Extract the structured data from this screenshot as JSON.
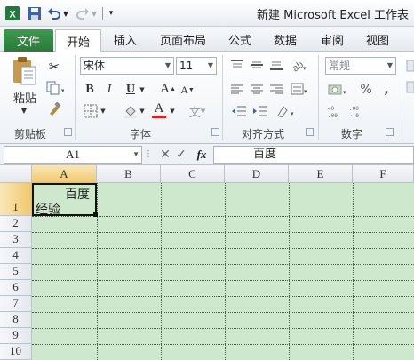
{
  "title_bar": {
    "title": "新建 Microsoft Excel 工作表"
  },
  "tabs": [
    {
      "id": "file",
      "label": "文件"
    },
    {
      "id": "home",
      "label": "开始"
    },
    {
      "id": "insert",
      "label": "插入"
    },
    {
      "id": "page_layout",
      "label": "页面布局"
    },
    {
      "id": "formulas",
      "label": "公式"
    },
    {
      "id": "data",
      "label": "数据"
    },
    {
      "id": "review",
      "label": "审阅"
    },
    {
      "id": "view",
      "label": "视图"
    }
  ],
  "ribbon": {
    "clipboard": {
      "paste_label": "粘贴",
      "group_label": "剪贴板"
    },
    "font": {
      "name": "宋体",
      "size": "11",
      "bold": "B",
      "italic": "I",
      "underline": "U",
      "grow": "A",
      "shrink": "A",
      "color_letter": "A",
      "phonetic": "文",
      "group_label": "字体",
      "font_color": "#e02020"
    },
    "alignment": {
      "group_label": "对齐方式"
    },
    "number": {
      "format": "常规",
      "percent": "%",
      "comma": ",",
      "group_label": "数字"
    }
  },
  "formula_bar": {
    "name_box": "A1",
    "fx": "fx",
    "content": "百度"
  },
  "grid": {
    "columns": [
      "A",
      "B",
      "C",
      "D",
      "E",
      "F"
    ],
    "rows": [
      "1",
      "2",
      "3",
      "4",
      "5",
      "6",
      "7",
      "8",
      "9",
      "10"
    ],
    "selected_cell": "A1",
    "a1_line1": "百度",
    "a1_line2": "经验",
    "fill_color": "#cde8cd"
  },
  "colors": {
    "file_tab": "#2a7a39",
    "selection_header": "#f2c96c"
  }
}
